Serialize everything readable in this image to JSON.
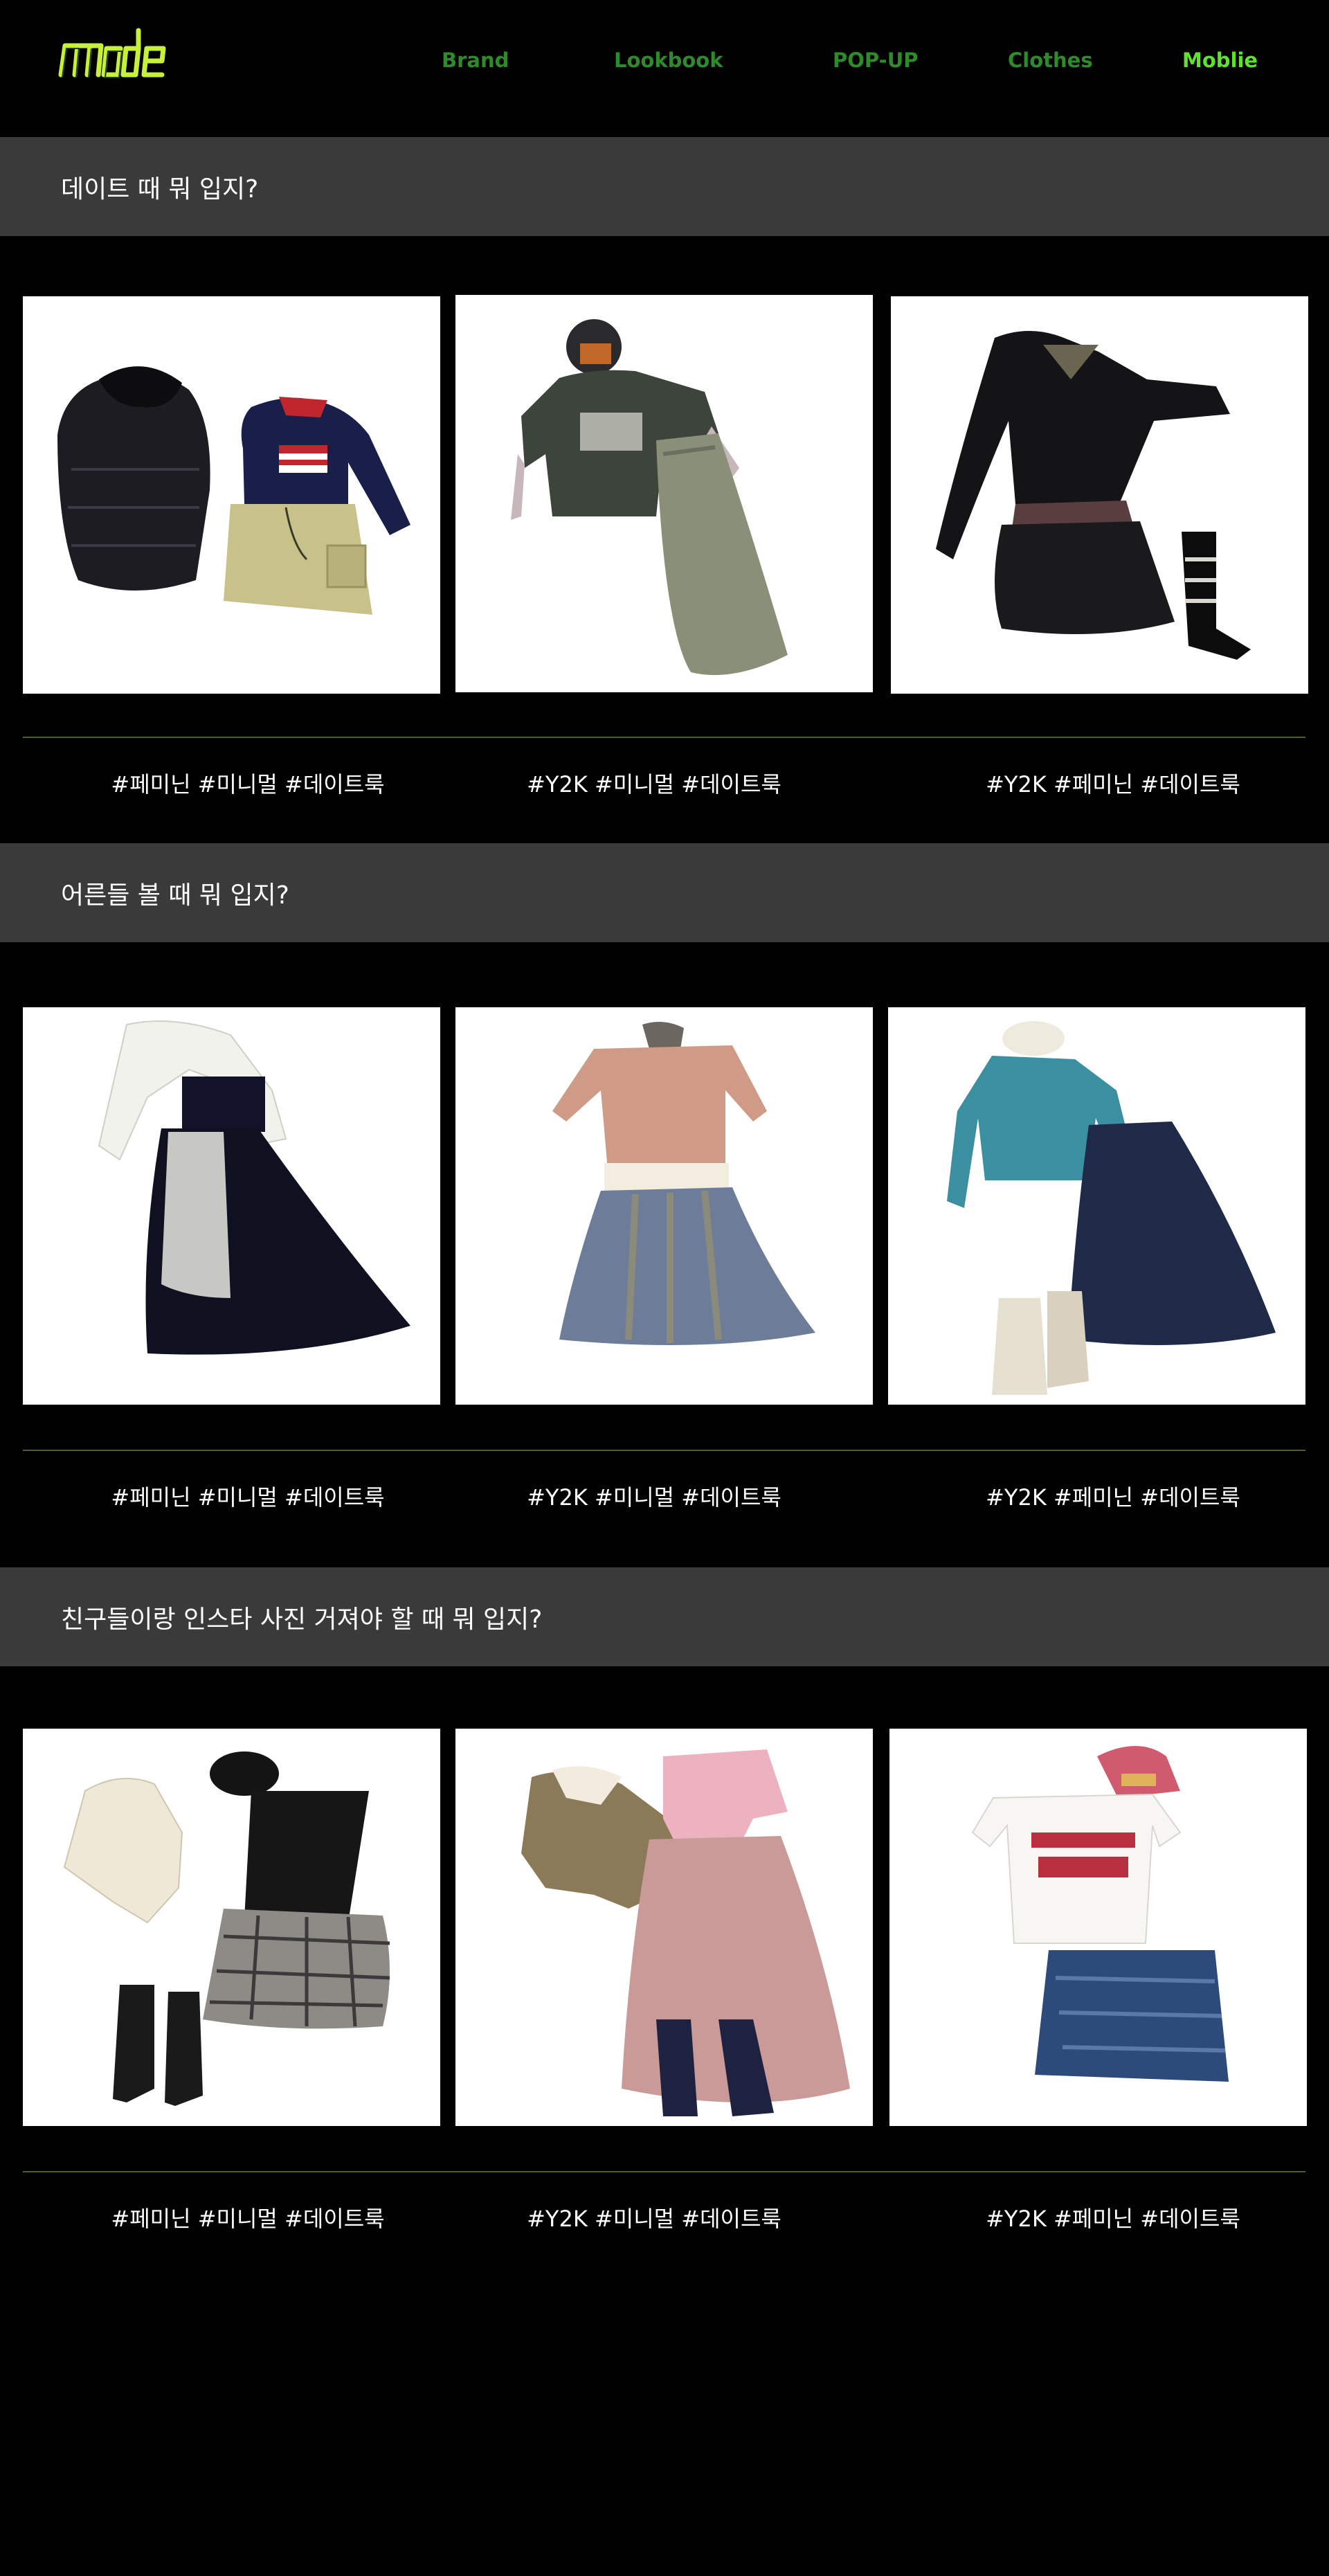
{
  "header": {
    "logo_text": "mode",
    "nav": [
      {
        "label": "Brand"
      },
      {
        "label": "Lookbook"
      },
      {
        "label": "POP-UP"
      },
      {
        "label": "Clothes"
      },
      {
        "label": "Moblie",
        "active": true
      }
    ]
  },
  "sections": [
    {
      "title": "데이트 때 뭐 입지?",
      "items": [
        {
          "tags": "#페미닌 #미니멀 #데이트룩",
          "image": "outfit-puffer-jacket-polo-mini-skirt"
        },
        {
          "tags": "#Y2K #미니멀 #데이트룩",
          "image": "outfit-camo-tee-cap-maxi-skirt"
        },
        {
          "tags": "#Y2K #페미닌 #데이트룩",
          "image": "outfit-black-lace-top-skirt-boots"
        }
      ]
    },
    {
      "title": "어른들 볼 때 뭐 입지?",
      "items": [
        {
          "tags": "#페미닌 #미니멀 #데이트룩",
          "image": "outfit-white-shirt-black-maxi-skirt"
        },
        {
          "tags": "#Y2K #미니멀 #데이트룩",
          "image": "outfit-pink-knit-scarf-patchwork-skirt"
        },
        {
          "tags": "#Y2K #페미닌 #데이트룩",
          "image": "outfit-teal-cardigan-denim-skirt-boots"
        }
      ]
    },
    {
      "title": "친구들이랑 인스타 사진 거져야 할 때 뭐 입지?",
      "items": [
        {
          "tags": "#페미닌 #미니멀 #데이트룩",
          "image": "outfit-knit-hoodie-beret-plaid-skirt"
        },
        {
          "tags": "#Y2K #미니멀 #데이트룩",
          "image": "outfit-shearling-jacket-pink-layers"
        },
        {
          "tags": "#Y2K #페미닌 #데이트룩",
          "image": "outfit-white-tee-cap-denim-mini"
        }
      ]
    }
  ],
  "colors": {
    "background": "#000000",
    "section_bar": "#3a3a3a",
    "nav_text": "#2e8b2a",
    "nav_active": "#5ee22b",
    "divider": "#4d5e2a"
  }
}
